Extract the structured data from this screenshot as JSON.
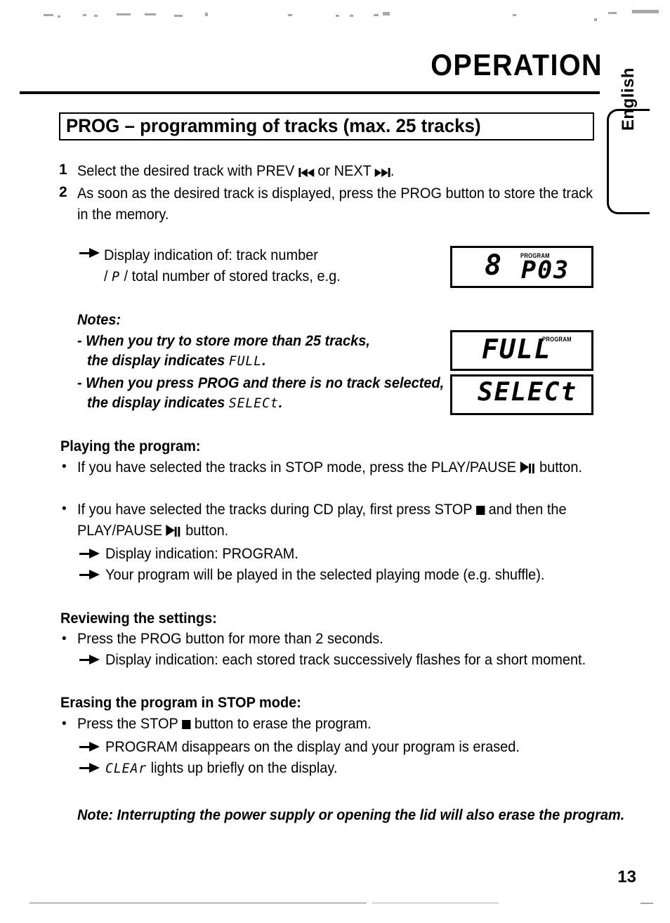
{
  "document": {
    "header_title": "OPERATION",
    "side_tab_label": "English",
    "page_number": "13"
  },
  "section": {
    "heading": "PROG – programming of tracks (max. 25 tracks)"
  },
  "steps": [
    {
      "number": "1",
      "text_before": "Select the desired track with PREV",
      "text_middle": "or NEXT",
      "text_after": "."
    },
    {
      "number": "2",
      "line1": "As soon as the desired track is displayed, press the PROG button to store the track",
      "line2": "in the memory."
    }
  ],
  "display_indication": {
    "line1": "Display indication of: track number",
    "line2_prefix": "/",
    "line2_code": "P",
    "line2_suffix": "/ total number of stored tracks, e.g."
  },
  "notes": {
    "title": "Notes:",
    "items": [
      {
        "line1": "- When you try to store more than 25 tracks,",
        "line2_text": "the display indicates",
        "line2_code": "FULL",
        "line2_end": "."
      },
      {
        "line1": "- When you press PROG and there is no track selected,",
        "line2_text": "the display indicates",
        "line2_code": "SELECt",
        "line2_end": "."
      }
    ]
  },
  "lcd_panels": [
    {
      "id": "track-program",
      "left_digit": "8",
      "main_text": "P03",
      "program_label": "PROGRAM",
      "program_label_visible": true
    },
    {
      "id": "full",
      "left_digit": "",
      "main_text": "FULL",
      "program_label": "PROGRAM",
      "program_label_visible": true
    },
    {
      "id": "select",
      "left_digit": "",
      "main_text": "SELECt",
      "program_label": "",
      "program_label_visible": false
    }
  ],
  "playing": {
    "title": "Playing the program:",
    "bullet1_before": "If you have selected the tracks in STOP mode, press the PLAY/PAUSE",
    "bullet1_after": "button.",
    "bullet2_before": "If you have selected the tracks during CD play, first press STOP",
    "bullet2_mid": "and then the",
    "bullet2_line2_before": "PLAY/PAUSE",
    "bullet2_line2_after": "button.",
    "arrow1": "Display indication: PROGRAM.",
    "arrow2": "Your program will be played in the selected playing mode (e.g. shuffle)."
  },
  "reviewing": {
    "title": "Reviewing the settings:",
    "bullet1": "Press the PROG button for more than 2 seconds.",
    "arrow1": "Display indication: each stored track successively flashes for a short moment."
  },
  "erasing": {
    "title": "Erasing the program in STOP mode:",
    "bullet1_before": "Press the STOP",
    "bullet1_after": "button to erase the program.",
    "arrow1": "PROGRAM disappears on the display and your program is erased.",
    "arrow2_code": "CLEAr",
    "arrow2_text": "lights up briefly on the display."
  },
  "footer_note": {
    "text": "Note: Interrupting the power supply or opening the lid will also erase the program."
  }
}
